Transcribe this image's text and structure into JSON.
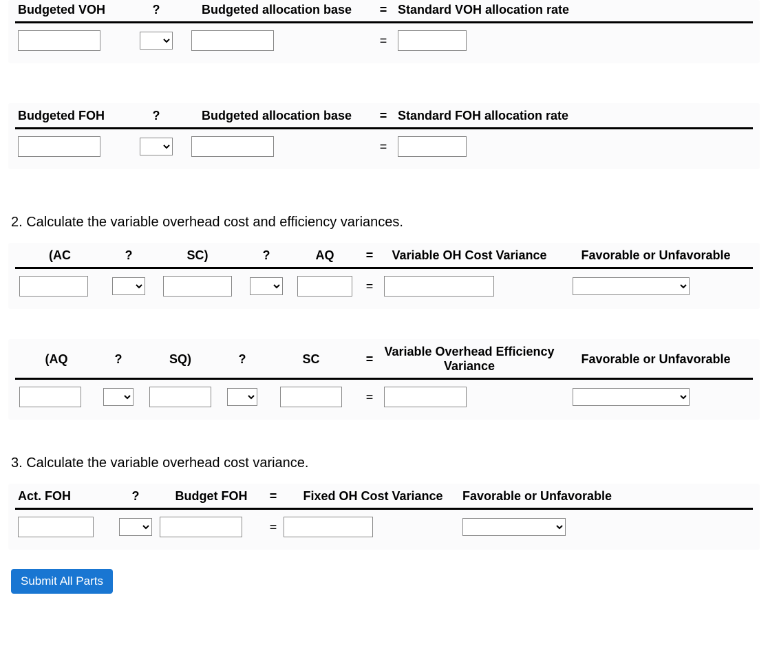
{
  "row1": {
    "h1": "Budgeted VOH",
    "h2": "?",
    "h3": "Budgeted allocation base",
    "eq": "=",
    "h4": "Standard VOH allocation rate"
  },
  "row2": {
    "h1": "Budgeted FOH",
    "h2": "?",
    "h3": "Budgeted allocation base",
    "eq": "=",
    "h4": "Standard FOH allocation rate"
  },
  "q2": "2. Calculate the variable overhead cost and efficiency variances.",
  "row3": {
    "h1": "(AC",
    "h2": "?",
    "h3": "SC)",
    "h4": "?",
    "h5": "AQ",
    "eq": "=",
    "h6": "Variable OH Cost Variance",
    "h7": "Favorable or Unfavorable"
  },
  "row4": {
    "h1": "(AQ",
    "h2": "?",
    "h3": "SQ)",
    "h4": "?",
    "h5": "SC",
    "eq": "=",
    "h6": "Variable Overhead Efficiency Variance",
    "h7": "Favorable or Unfavorable"
  },
  "q3": "3. Calculate the variable overhead cost variance.",
  "row5": {
    "h1": "Act. FOH",
    "h2": "?",
    "h3": "Budget FOH",
    "eq": "=",
    "h4": "Fixed OH Cost Variance",
    "h5": "Favorable or Unfavorable"
  },
  "equals": "=",
  "submit": "Submit All Parts"
}
